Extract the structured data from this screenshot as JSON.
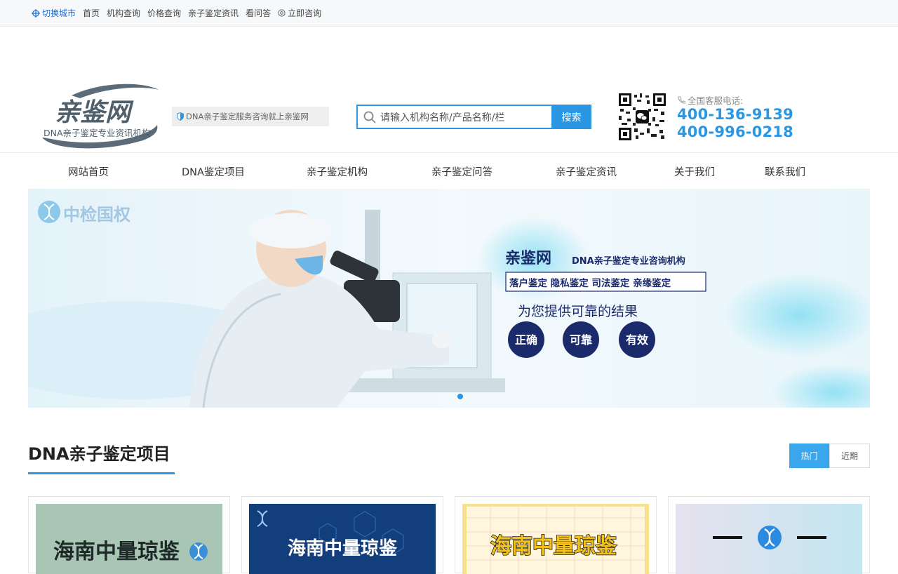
{
  "topbar": {
    "city": "切换城市",
    "links": [
      "首页",
      "机构查询",
      "价格查询",
      "亲子鉴定资讯",
      "看问答"
    ],
    "consult": "立即咨询"
  },
  "header": {
    "logo_main": "亲鉴网",
    "logo_sub": "DNA亲子鉴定专业资讯机构",
    "slogan": "DNA亲子鉴定服务咨询就上亲鉴网",
    "search_placeholder": "请输入机构名称/产品名称/栏",
    "search_button": "搜索",
    "phone_label": "全国客服电话:",
    "phone1": "400-136-9139",
    "phone2": "400-996-0218"
  },
  "nav": [
    "网站首页",
    "DNA鉴定项目",
    "亲子鉴定机构",
    "亲子鉴定问答",
    "亲子鉴定资讯",
    "关于我们",
    "联系我们"
  ],
  "banner": {
    "org_logo": "中检国权",
    "brand": "亲鉴网",
    "brand_sub": "DNA亲子鉴定专业咨询机构",
    "services": "落户鉴定 隐私鉴定 司法鉴定 亲缘鉴定",
    "tagline": "为您提供可靠的结果",
    "badges": [
      "正确",
      "可靠",
      "有效"
    ]
  },
  "section": {
    "title": "DNA亲子鉴定项目",
    "tab_hot": "热门",
    "tab_recent": "近期"
  },
  "cards": [
    {
      "title": "海南中量琼鉴"
    },
    {
      "title": "海南中量琼鉴"
    },
    {
      "title": "海南中量琼鉴"
    },
    {
      "title": ""
    }
  ],
  "colors": {
    "accent": "#2b96e1",
    "banner_navy": "#1b2a6b"
  }
}
